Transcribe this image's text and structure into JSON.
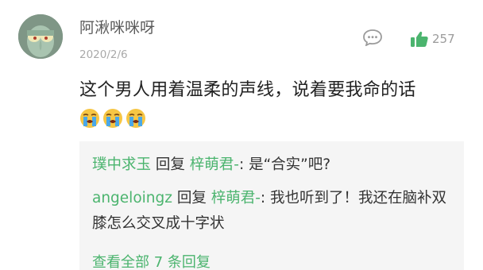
{
  "comment": {
    "username": "阿湫咪咪呀",
    "date": "2020/2/6",
    "text": "这个男人用着温柔的声线，说着要我命的话",
    "like_count": "257",
    "emojis": [
      "crying-emoji",
      "crying-emoji",
      "crying-emoji"
    ]
  },
  "replies": [
    {
      "from": "璞中求玉",
      "verb": " 回复 ",
      "to": "梓萌君-",
      "text": ": 是“合实”吧?"
    },
    {
      "from": "angeloingz",
      "verb": " 回复 ",
      "to": "梓萌君-",
      "text": ": 我也听到了！我还在脑补双膝怎么交叉成十字状"
    }
  ],
  "more_replies": "查看全部 7 条回复",
  "colors": {
    "accent_green": "#4bb46e",
    "reply_bg": "#f5f5f5",
    "text": "#222222",
    "meta": "#a9a9a9"
  },
  "icons": {
    "reply": "chat-bubble-icon",
    "like": "thumbs-up-icon"
  }
}
